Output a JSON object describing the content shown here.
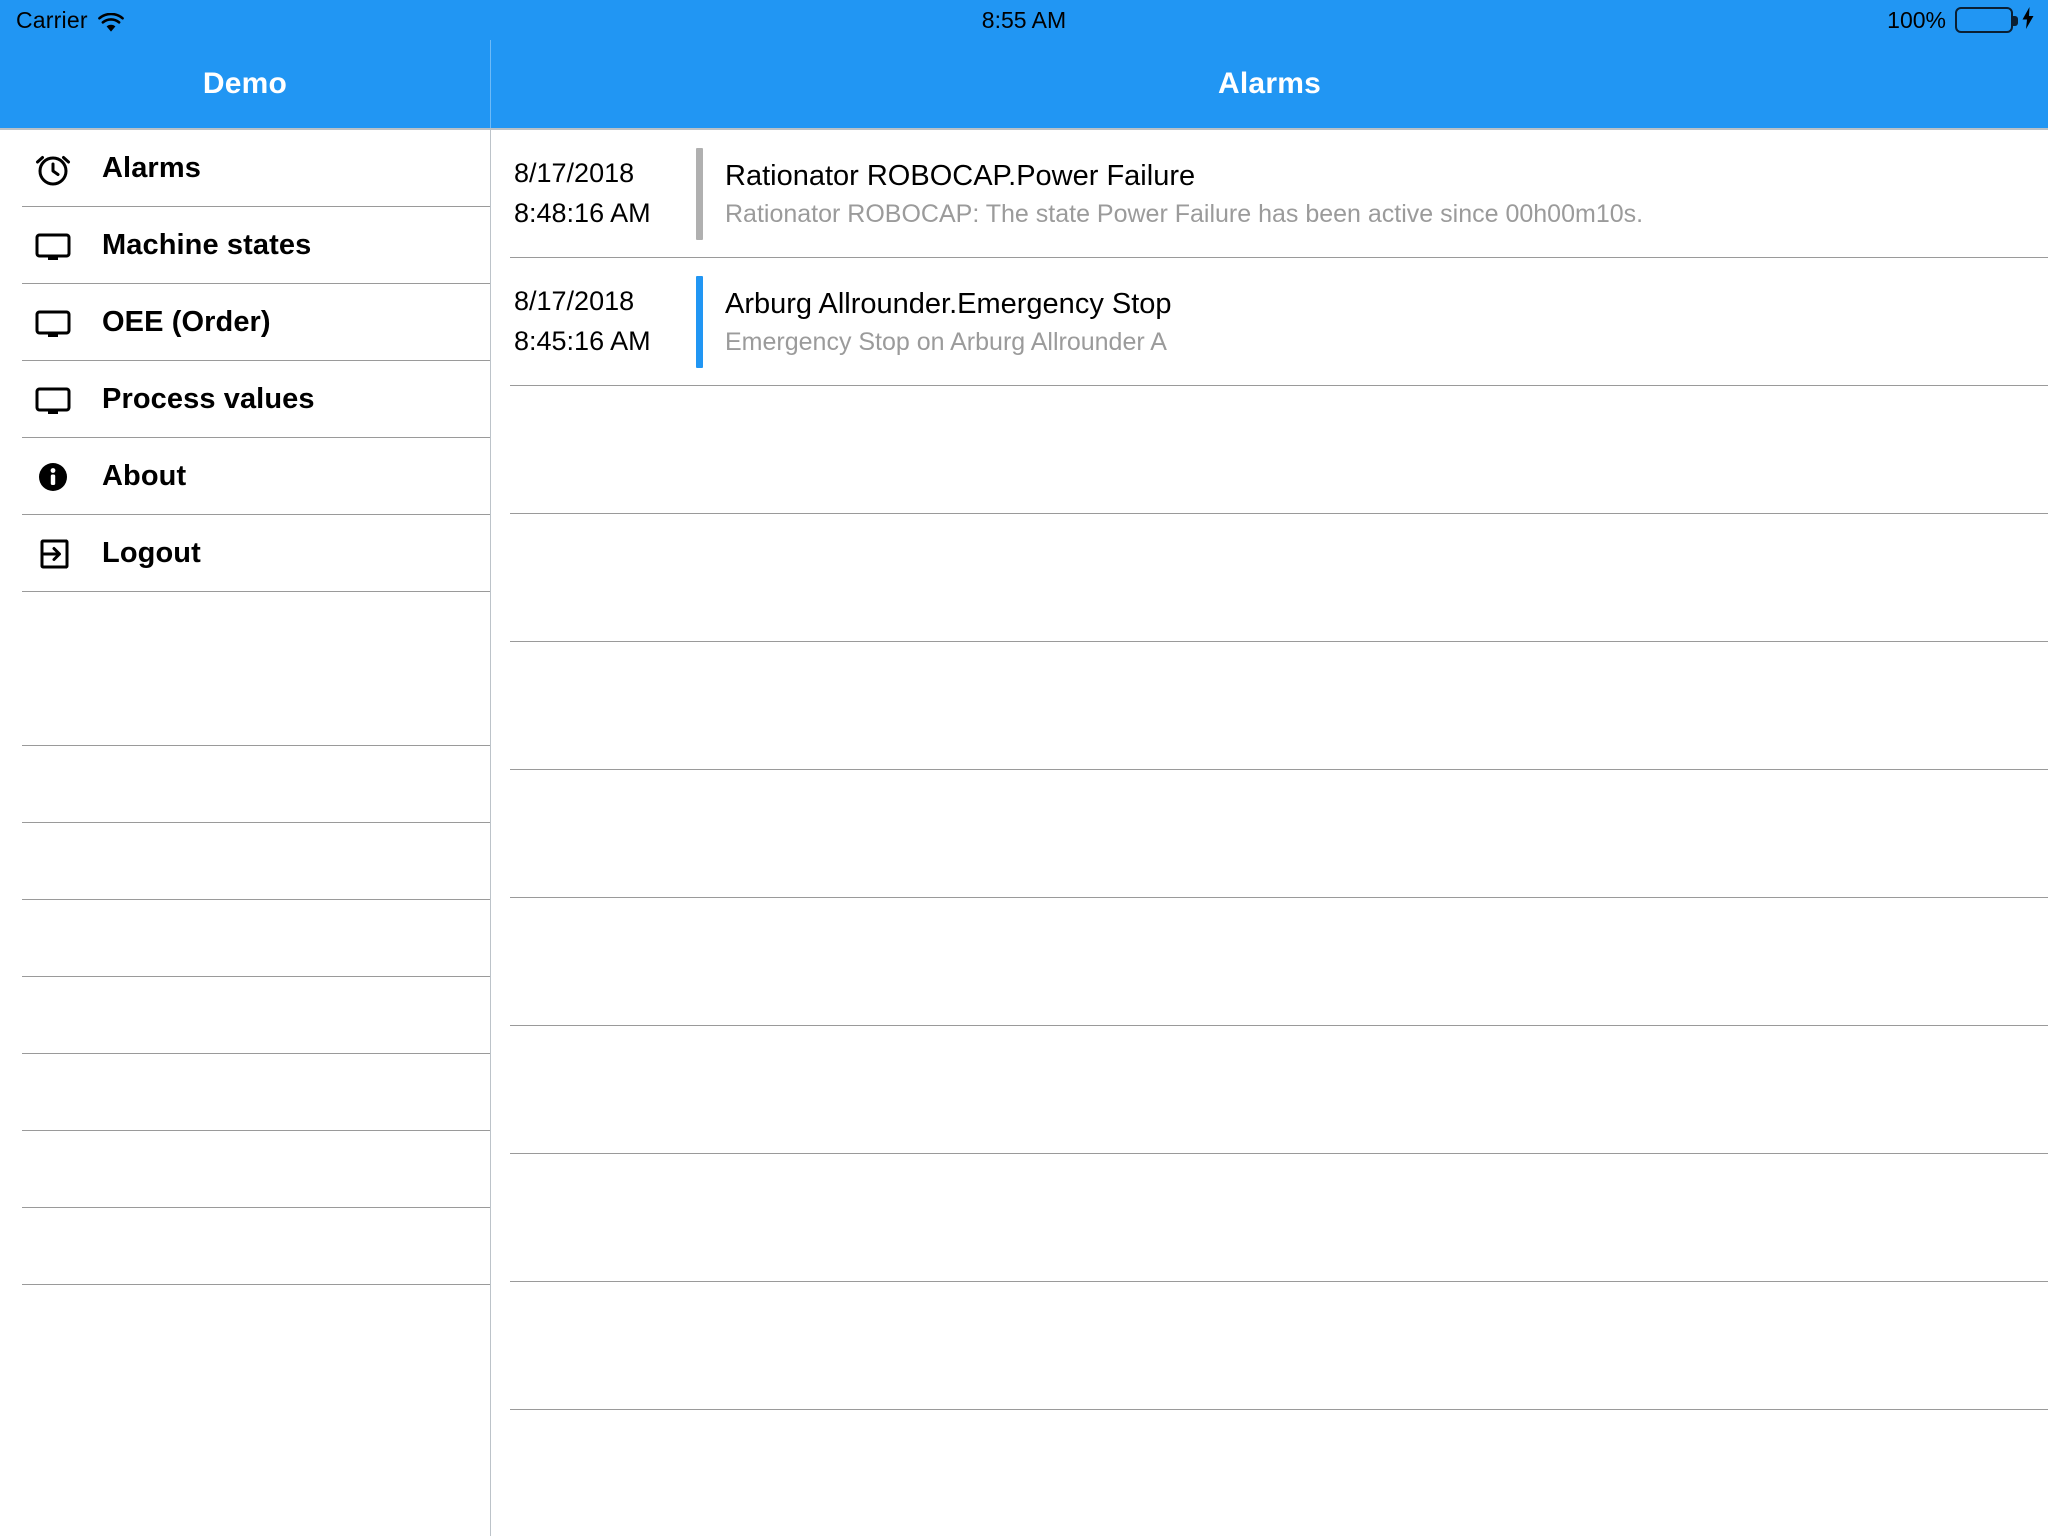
{
  "status_bar": {
    "carrier": "Carrier",
    "wifi_icon": "wifi-icon",
    "time": "8:55 AM",
    "battery_percent": "100%",
    "battery_icon": "battery-full-icon",
    "charging_icon": "lightning-bolt-icon"
  },
  "colors": {
    "accent": "#2196f3",
    "navbar": "#2196f3",
    "battery_fill": "#4cd964",
    "alarm_bar_inactive": "#b0b0b0",
    "alarm_bar_active": "#2196f3",
    "subtitle_gray": "#9b9b9b",
    "divider": "#9a9a9a"
  },
  "sidebar": {
    "title": "Demo",
    "items": [
      {
        "label": "Alarms",
        "icon": "alarm-clock-icon"
      },
      {
        "label": "Machine states",
        "icon": "monitor-icon"
      },
      {
        "label": "OEE (Order)",
        "icon": "monitor-icon"
      },
      {
        "label": "Process values",
        "icon": "monitor-icon"
      },
      {
        "label": "About",
        "icon": "info-circle-icon"
      },
      {
        "label": "Logout",
        "icon": "logout-icon"
      }
    ],
    "empty_row_count": 7
  },
  "main": {
    "title": "Alarms",
    "alarms": [
      {
        "date": "8/17/2018",
        "time": "8:48:16 AM",
        "title": "Rationator ROBOCAP.Power Failure",
        "subtitle": "Rationator ROBOCAP: The state Power Failure has been active since 00h00m10s.",
        "severity_color": "#b0b0b0"
      },
      {
        "date": "8/17/2018",
        "time": "8:45:16 AM",
        "title": "Arburg Allrounder.Emergency Stop",
        "subtitle": "Emergency Stop on Arburg Allrounder A",
        "severity_color": "#2196f3"
      }
    ],
    "empty_row_count": 9
  }
}
